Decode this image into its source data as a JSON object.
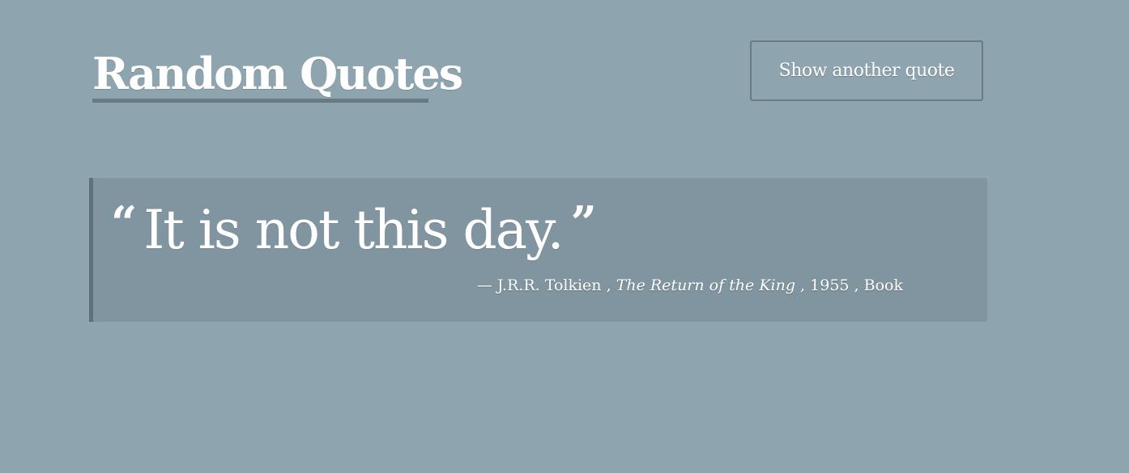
{
  "header": {
    "title": "Random Quotes"
  },
  "toolbar": {
    "show_another_label": "Show another quote"
  },
  "quote": {
    "open_mark": "“",
    "text": "It is not this day.",
    "close_mark": "”",
    "attribution": {
      "dash": "—",
      "author": "J.R.R. Tolkien",
      "separator": ",",
      "work": "The Return of the King",
      "year": "1955",
      "type": "Book"
    }
  },
  "colors": {
    "background": "#8ea4ae",
    "quote_box": "#80959f",
    "accent_border": "#687a84",
    "text": "#ffffff"
  }
}
